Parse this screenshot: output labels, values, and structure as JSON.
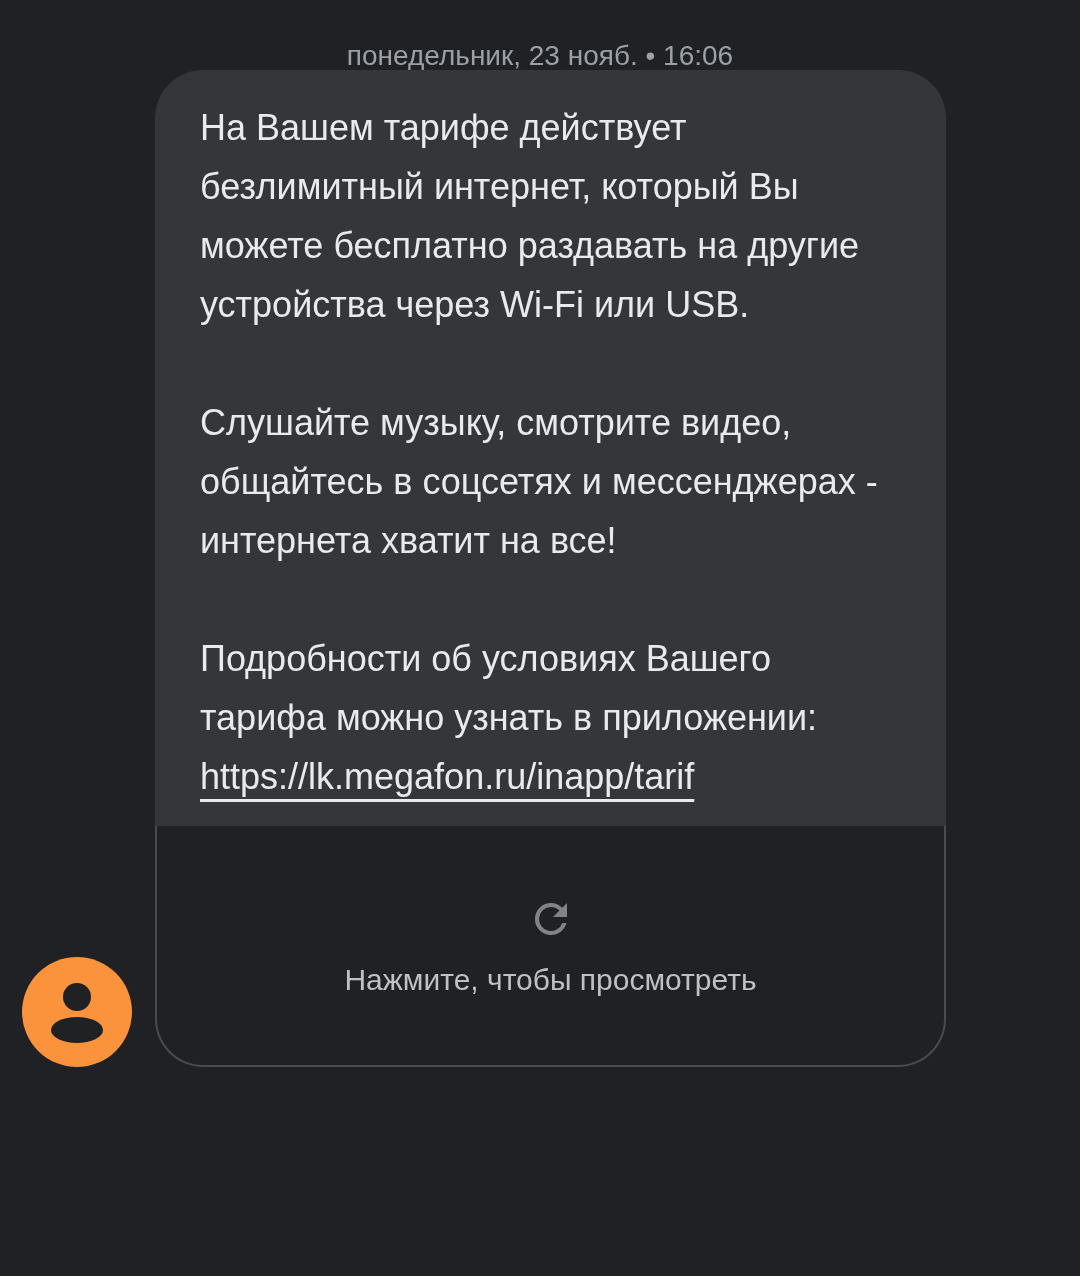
{
  "timestamp": "понедельник, 23 нояб. • 16:06",
  "message": {
    "paragraphs": [
      {
        "text": "На Вашем тарифе действует безлимитный интернет, который Вы можете бесплатно раздавать на другие устройства через Wi-Fi или USB."
      },
      {
        "text": "Слушайте музыку, смотрите видео, общайтесь в соцсетях и мессенджерах - интернета хватит на все!"
      },
      {
        "text": "Подробности об условиях Вашего тарифа можно узнать в приложении: ",
        "link": "https://lk.megafon.ru/inapp/tarif"
      }
    ],
    "attachment": {
      "label": "Нажмите, чтобы просмотреть"
    }
  }
}
